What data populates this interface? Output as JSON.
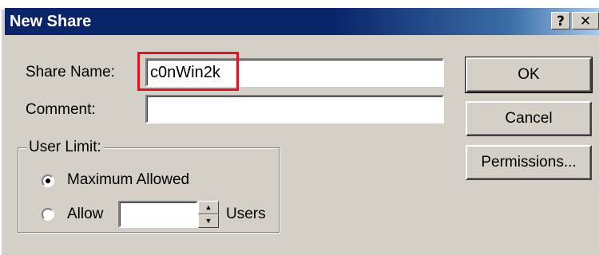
{
  "window": {
    "title": "New Share",
    "help_glyph": "?",
    "close_glyph": "✕"
  },
  "form": {
    "share_name_label": "Share Name:",
    "share_name_value": "c0nWin2k",
    "comment_label": "Comment:",
    "comment_value": ""
  },
  "user_limit": {
    "group_label": "User Limit:",
    "options": [
      {
        "label": "Maximum Allowed",
        "selected": true
      },
      {
        "label": "Allow",
        "selected": false
      }
    ],
    "allow_value": "",
    "users_label": "Users"
  },
  "buttons": {
    "ok": "OK",
    "cancel": "Cancel",
    "permissions": "Permissions..."
  },
  "colors": {
    "highlight_box": "#e0141e",
    "titlebar": "#0a246a"
  }
}
